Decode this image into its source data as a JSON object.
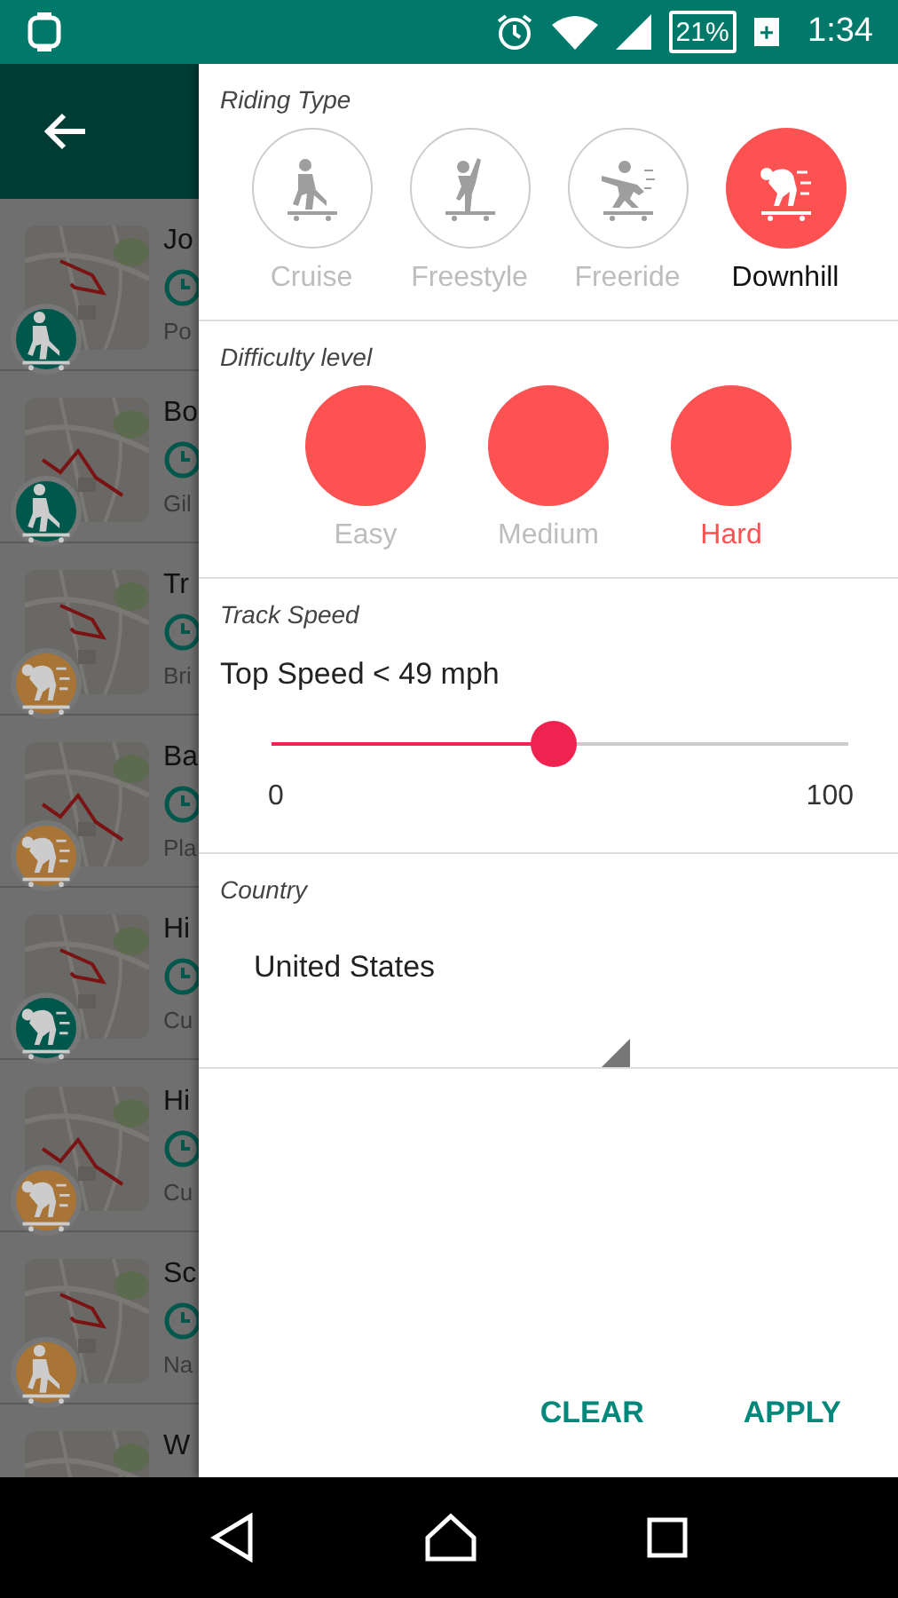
{
  "status_bar": {
    "battery": "21%",
    "charging": "+",
    "time": "1:34"
  },
  "list": [
    {
      "title": "Jo",
      "subtitle": "Po",
      "kind": "cruise",
      "color": "#00574c"
    },
    {
      "title": "Bo",
      "subtitle": "Gil",
      "kind": "cruise",
      "color": "#00574c"
    },
    {
      "title": "Tr",
      "subtitle": "Bri",
      "kind": "downhill",
      "color": "#a87536"
    },
    {
      "title": "Ba",
      "subtitle": "Pla",
      "kind": "downhill",
      "color": "#a87536"
    },
    {
      "title": "Hi",
      "subtitle": "Cu",
      "kind": "downhill",
      "color": "#00574c"
    },
    {
      "title": "Hi",
      "subtitle": "Cu",
      "kind": "downhill",
      "color": "#a87536"
    },
    {
      "title": "Sc",
      "subtitle": "Na",
      "kind": "cruise",
      "color": "#a87536"
    },
    {
      "title": "W"
    }
  ],
  "filter": {
    "riding_type": {
      "label": "Riding Type",
      "options": [
        {
          "label": "Cruise",
          "kind": "cruise",
          "selected": false
        },
        {
          "label": "Freestyle",
          "kind": "freestyle",
          "selected": false
        },
        {
          "label": "Freeride",
          "kind": "freeride",
          "selected": false
        },
        {
          "label": "Downhill",
          "kind": "downhill",
          "selected": true
        }
      ]
    },
    "difficulty": {
      "label": "Difficulty level",
      "options": [
        {
          "label": "Easy",
          "selected": false
        },
        {
          "label": "Medium",
          "selected": false
        },
        {
          "label": "Hard",
          "selected": true
        }
      ]
    },
    "track_speed": {
      "label": "Track Speed",
      "reading": "Top Speed < 49  mph",
      "level": 0.49,
      "min": "0",
      "max": "100"
    },
    "country": {
      "label": "Country",
      "value": "United States"
    },
    "buttons": [
      "CLEAR",
      "APPLY"
    ]
  }
}
